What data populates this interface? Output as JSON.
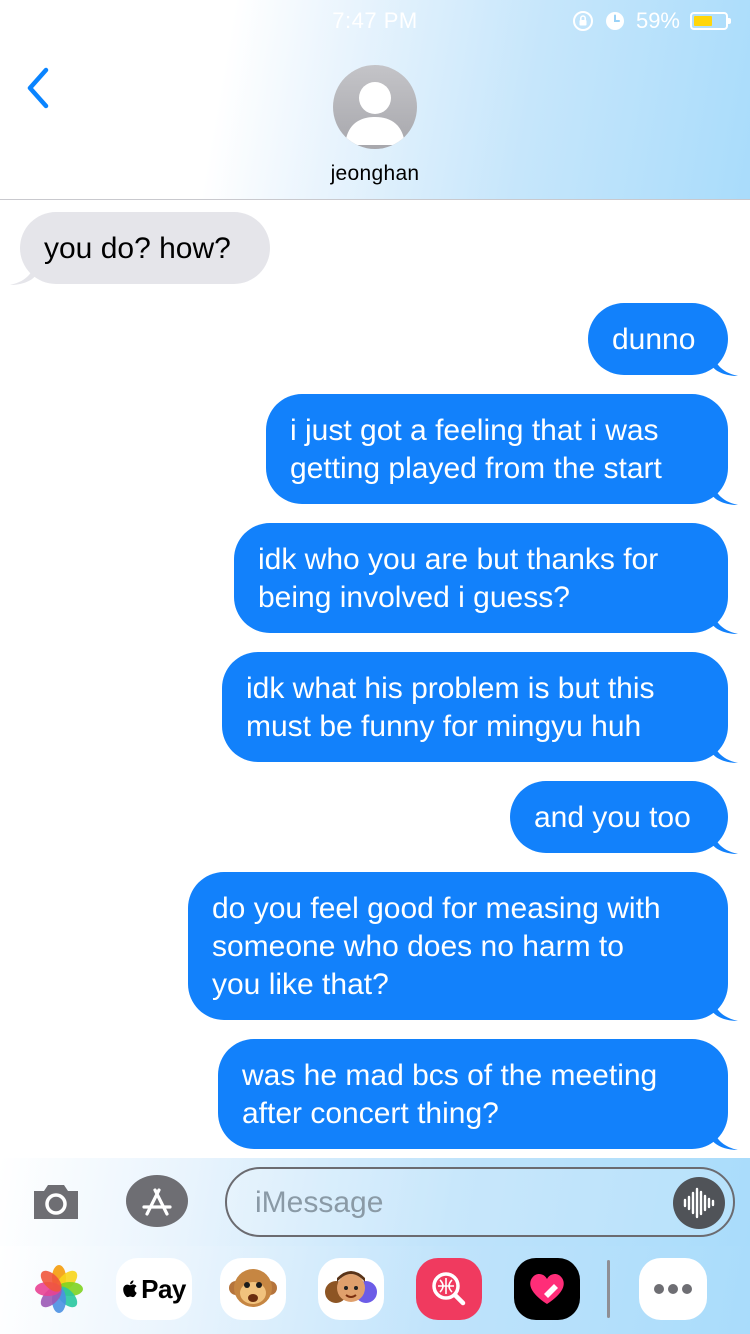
{
  "status_bar": {
    "time": "7:47 PM",
    "battery_percent": "59%",
    "battery_level": 0.59,
    "icons": [
      "orientation-lock-icon",
      "alarm-icon",
      "battery-icon"
    ]
  },
  "conversation": {
    "contact_name": "jeonghan",
    "back_icon": "chevron-left-icon",
    "avatar_icon": "person-silhouette-icon"
  },
  "messages": [
    {
      "dir": "in",
      "lines": [
        "you do? how?"
      ]
    },
    {
      "dir": "out",
      "lines": [
        "dunno"
      ]
    },
    {
      "dir": "out",
      "lines": [
        "i just got a feeling that i was",
        "getting played from the start"
      ]
    },
    {
      "dir": "out",
      "lines": [
        "idk who you are but thanks for",
        "being involved i guess?"
      ]
    },
    {
      "dir": "out",
      "lines": [
        "idk what his problem is but this",
        "must be funny for mingyu huh"
      ]
    },
    {
      "dir": "out",
      "lines": [
        "and you too"
      ]
    },
    {
      "dir": "out",
      "lines": [
        "do you feel good for measing with",
        "someone who does no harm to",
        "you like that?"
      ]
    },
    {
      "dir": "out",
      "lines": [
        "was he mad bcs of the meeting",
        "after concert thing?"
      ]
    }
  ],
  "input_bar": {
    "placeholder": "iMessage",
    "camera_icon": "camera-icon",
    "appstore_icon": "app-store-icon",
    "audio_icon": "audio-waveform-icon"
  },
  "app_drawer": {
    "pay_label": "Pay",
    "apps": [
      "photos-icon",
      "apple-pay-icon",
      "animoji-icon",
      "memoji-icon",
      "search-images-icon",
      "digital-touch-icon",
      "more-apps-icon"
    ]
  },
  "colors": {
    "outgoing_bubble": "#1281fb",
    "incoming_bubble": "#e5e5ea",
    "accent": "#0a84ff"
  }
}
